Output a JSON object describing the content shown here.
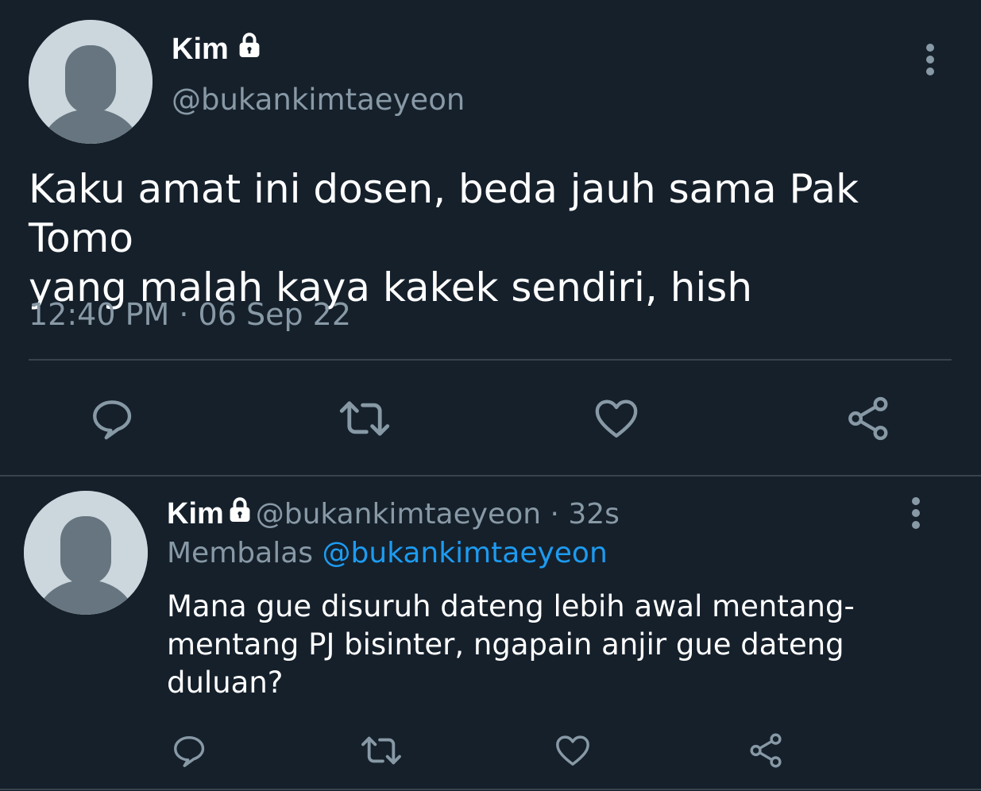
{
  "tweet": {
    "display_name": "Kim",
    "handle": "@bukankimtaeyeon",
    "text": "Kaku amat ini dosen, beda jauh sama Pak Tomo\nyang malah kaya kakek sendiri, hish",
    "time": "12:40 PM",
    "separator": " · ",
    "date": "06 Sep 22"
  },
  "reply": {
    "display_name": "Kim",
    "handle": "@bukankimtaeyeon",
    "separator": " · ",
    "age": "32s",
    "replying_label": "Membalas",
    "replying_to": "@bukankimtaeyeon",
    "text": "Mana gue disuruh dateng lebih awal mentang-\nmentang PJ bisinter, ngapain anjir gue dateng\nduluan?"
  },
  "icons": {
    "lock": "lock-icon",
    "more": "more-vertical-icon",
    "reply": "reply-icon",
    "retweet": "retweet-icon",
    "like": "heart-icon",
    "share": "share-icon"
  },
  "colors": {
    "background": "#15202b",
    "muted_text": "#8899a6",
    "icon": "#8899a6",
    "link": "#1d9bf0",
    "divider": "#38444d"
  }
}
